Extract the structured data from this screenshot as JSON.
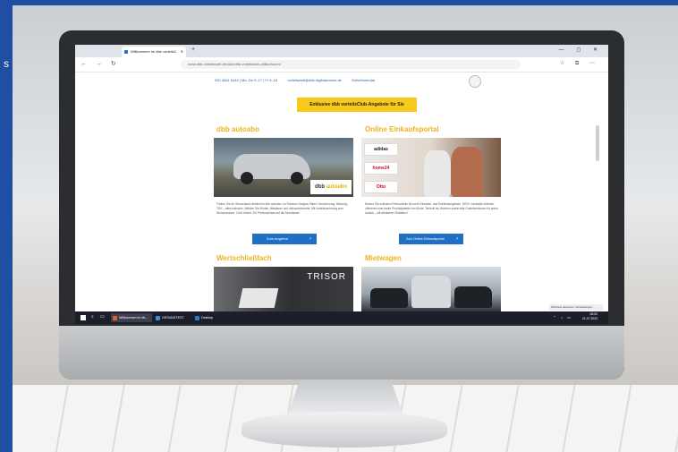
{
  "browser": {
    "tab_title": "Willkommen im dbb vorteilsC",
    "tab_close": "✕",
    "new_tab": "+",
    "window_controls": "— ◻ ✕",
    "nav_icons": "← → ↻",
    "url": "www.dbb-vorteilswelt.de/club/dbb-vorteilsclub-willkommen/",
    "tool_icons": "☆ ⧉ ⋯"
  },
  "header": {
    "phone": "030 4081 6444 | Mo.-Do 9–17 | Fr 9–15",
    "email": "vorteilswelt@dbb-digitalservice.de",
    "info": "Onlineformular"
  },
  "banner": {
    "text": "Exklusive dbb vorteilsClub-Angebote für Sie"
  },
  "sections": {
    "autoabo": {
      "title": "dbb autoabo",
      "logo_main": "dbb",
      "logo_accent": "autoabo",
      "text": "Fahren Sie Ihr Wunschauto flexibel im dbb autoabo. Im Rundum-Sorglos-Paket: Versicherung, Wartung, TÜV – alles inklusive. Wählen Sie Modell, Mietdauer und Inklusivkilometer. Mit Vorteilsrechnung zum Wunschdatum. Club-Vorteil: 3% Preisnachlass auf die Monatsrate",
      "button": "Zum Angebot"
    },
    "einkauf": {
      "title": "Online Einkaufsportal",
      "brands": [
        "adidas",
        "home24",
        "Otto"
      ],
      "text": "Nutzen Sie exklusive Preisvorteile für mehr Einkaufs- und Erlebnisangebote. 1500+ namhafte Anbieter offerieren eine breite Produktpalette von Mode, Technik bis Wohnen sowie tolle Gutscheinboxen für jeden Anlass – mit attraktiven Rabatten!",
      "button": "Zum Online-Einkaufsportal"
    },
    "wertschliessfach": {
      "title": "Wertschließfach",
      "brand": "TRISOR"
    },
    "mietwagen": {
      "title": "Mietwagen"
    }
  },
  "taskbar": {
    "items": [
      {
        "label": "Willkommen im db..."
      },
      {
        "label": "GESUNDTEST"
      },
      {
        "label": "Desktop"
      }
    ],
    "tray_icons": "⌃ ♪ ▭",
    "time": "08:52",
    "date": "21.07.2023"
  },
  "toast": "Windows aktivieren / Einstellungen",
  "colors": {
    "accent": "#f6c91a",
    "button": "#1f6fc5",
    "frame": "#1f4ea3"
  }
}
